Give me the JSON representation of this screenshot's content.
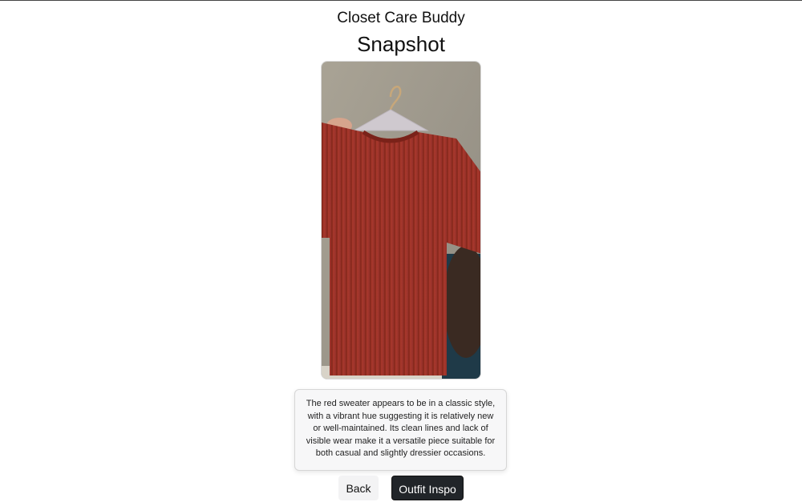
{
  "header": {
    "app_title": "Closet Care Buddy",
    "page_title": "Snapshot"
  },
  "photo": {
    "subject": "red ribbed short-sleeve sweater on a hanger"
  },
  "description": {
    "text": "The red sweater appears to be in a classic style, with a vibrant hue suggesting it is relatively new or well-maintained. Its clean lines and lack of visible wear make it a versatile piece suitable for both casual and slightly dressier occasions."
  },
  "actions": {
    "back_label": "Back",
    "outfit_inspo_label": "Outfit Inspo"
  },
  "colors": {
    "sweater": "#a8382c",
    "primary_button": "#212529",
    "secondary_button": "#f3f3f4"
  }
}
